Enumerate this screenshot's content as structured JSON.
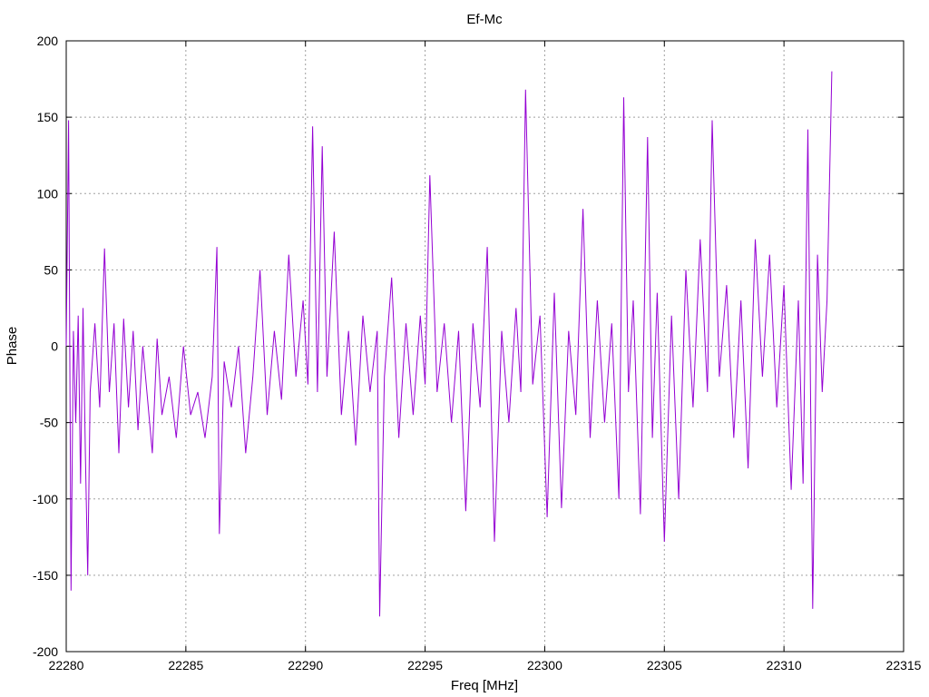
{
  "chart_data": {
    "type": "line",
    "title": "Ef-Mc",
    "xlabel": "Freq [MHz]",
    "ylabel": "Phase",
    "xlim": [
      22280,
      22315
    ],
    "ylim": [
      -200,
      200
    ],
    "x_ticks": [
      22280,
      22285,
      22290,
      22295,
      22300,
      22305,
      22310,
      22315
    ],
    "y_ticks": [
      -200,
      -150,
      -100,
      -50,
      0,
      50,
      100,
      150,
      200
    ],
    "grid": true,
    "line_color": "#9400d3",
    "series": [
      {
        "x": [
          22280,
          22280.1,
          22280.2,
          22280.3,
          22280.4,
          22280.5,
          22280.6,
          22280.7,
          22280.8,
          22280.9,
          22281,
          22281.2,
          22281.4,
          22281.6,
          22281.8,
          22282,
          22282.2,
          22282.4,
          22282.6,
          22282.8,
          22283,
          22283.2,
          22283.4,
          22283.6,
          22283.8,
          22284,
          22284.3,
          22284.6,
          22284.9,
          22285.2,
          22285.5,
          22285.8,
          22286.1,
          22286.3,
          22286.4,
          22286.6,
          22286.9,
          22287.2,
          22287.5,
          22287.8,
          22288.1,
          22288.4,
          22288.7,
          22289,
          22289.3,
          22289.6,
          22289.9,
          22290.1,
          22290.3,
          22290.5,
          22290.7,
          22290.9,
          22291.2,
          22291.5,
          22291.8,
          22292.1,
          22292.4,
          22292.7,
          22293,
          22293.1,
          22293.3,
          22293.6,
          22293.9,
          22294.2,
          22294.5,
          22294.8,
          22295,
          22295.2,
          22295.5,
          22295.8,
          22296.1,
          22296.4,
          22296.7,
          22297,
          22297.3,
          22297.6,
          22297.9,
          22298.2,
          22298.5,
          22298.8,
          22299,
          22299.2,
          22299.5,
          22299.8,
          22300.1,
          22300.4,
          22300.7,
          22301,
          22301.3,
          22301.6,
          22301.9,
          22302.2,
          22302.5,
          22302.8,
          22303.1,
          22303.3,
          22303.5,
          22303.7,
          22304,
          22304.3,
          22304.5,
          22304.7,
          22305,
          22305.3,
          22305.6,
          22305.9,
          22306.2,
          22306.5,
          22306.8,
          22307,
          22307.3,
          22307.6,
          22307.9,
          22308.2,
          22308.5,
          22308.8,
          22309.1,
          22309.4,
          22309.7,
          22310,
          22310.3,
          22310.6,
          22310.8,
          22311,
          22311.2,
          22311.4,
          22311.6,
          22311.8,
          22312
        ],
        "y": [
          0,
          148,
          -160,
          10,
          -50,
          20,
          -90,
          25,
          -70,
          -150,
          -30,
          15,
          -40,
          64,
          -30,
          15,
          -70,
          18,
          -40,
          10,
          -55,
          0,
          -35,
          -70,
          5,
          -45,
          -20,
          -60,
          0,
          -45,
          -30,
          -60,
          -20,
          65,
          -123,
          -10,
          -40,
          0,
          -70,
          -20,
          50,
          -45,
          10,
          -35,
          60,
          -20,
          30,
          -25,
          144,
          -30,
          131,
          -20,
          75,
          -45,
          10,
          -65,
          20,
          -30,
          10,
          -177,
          -20,
          45,
          -60,
          15,
          -45,
          20,
          -25,
          112,
          -30,
          15,
          -50,
          10,
          -108,
          15,
          -40,
          65,
          -128,
          10,
          -50,
          25,
          -30,
          168,
          -25,
          20,
          -112,
          35,
          -106,
          10,
          -45,
          90,
          -60,
          30,
          -50,
          15,
          -100,
          163,
          -30,
          30,
          -110,
          137,
          -60,
          35,
          -128,
          20,
          -100,
          50,
          -40,
          70,
          -30,
          148,
          -20,
          40,
          -60,
          30,
          -80,
          70,
          -20,
          60,
          -40,
          40,
          -94,
          30,
          -90,
          142,
          -172,
          60,
          -30,
          30,
          180
        ]
      }
    ]
  }
}
